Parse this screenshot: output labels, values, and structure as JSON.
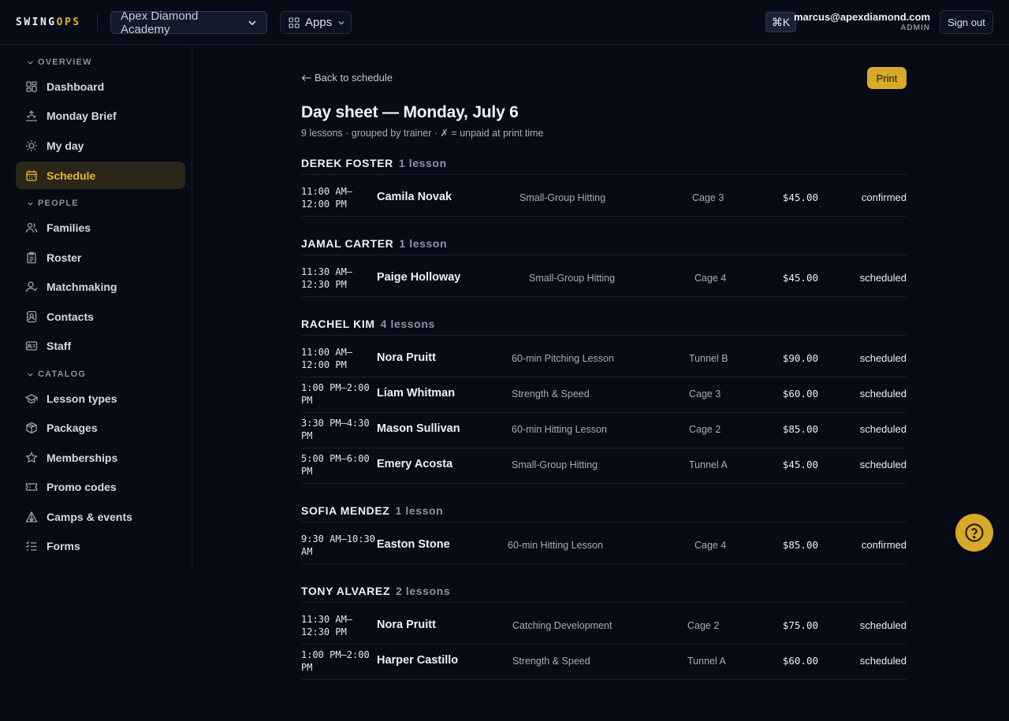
{
  "header": {
    "logo_main": "SWING",
    "logo_accent": "OPS",
    "org_name": "Apex Diamond Academy",
    "apps_label": "Apps",
    "shortcut_label": "⌘K",
    "user_email": "marcus@apexdiamond.com",
    "user_role": "ADMIN",
    "signout_label": "Sign out"
  },
  "sidebar": {
    "overview_label": "OVERVIEW",
    "people_label": "PEOPLE",
    "catalog_label": "CATALOG",
    "items": [
      {
        "label": "Dashboard",
        "icon": "grid-icon"
      },
      {
        "label": "Monday Brief",
        "icon": "sunrise-icon"
      },
      {
        "label": "My day",
        "icon": "sun-icon"
      },
      {
        "label": "Schedule",
        "icon": "calendar-icon",
        "active": true
      },
      {
        "label": "Families",
        "icon": "users-icon"
      },
      {
        "label": "Roster",
        "icon": "clipboard-icon"
      },
      {
        "label": "Matchmaking",
        "icon": "user-match-icon"
      },
      {
        "label": "Contacts",
        "icon": "contact-book-icon"
      },
      {
        "label": "Staff",
        "icon": "id-card-icon"
      },
      {
        "label": "Lesson types",
        "icon": "graduation-cap-icon"
      },
      {
        "label": "Packages",
        "icon": "box-icon"
      },
      {
        "label": "Memberships",
        "icon": "star-icon"
      },
      {
        "label": "Promo codes",
        "icon": "ticket-icon"
      },
      {
        "label": "Camps & events",
        "icon": "tent-icon"
      },
      {
        "label": "Forms",
        "icon": "checklist-icon"
      }
    ]
  },
  "main": {
    "back_label": "Back to schedule",
    "print_label": "Print",
    "title": "Day sheet — Monday, July 6",
    "subtitle": "9 lessons · grouped by trainer · ✗ = unpaid at print time",
    "trainers": [
      {
        "name": "DEREK FOSTER",
        "count": "1 lesson",
        "lessons": [
          {
            "time": "11:00 AM–12:00 PM",
            "student": "Camila Novak",
            "type": "Small-Group Hitting",
            "location": "Cage 3",
            "price": "$45.00",
            "status": "confirmed"
          }
        ]
      },
      {
        "name": "JAMAL CARTER",
        "count": "1 lesson",
        "lessons": [
          {
            "time": "11:30 AM–12:30 PM",
            "student": "Paige Holloway",
            "type": "Small-Group Hitting",
            "location": "Cage 4",
            "price": "$45.00",
            "status": "scheduled"
          }
        ]
      },
      {
        "name": "RACHEL KIM",
        "count": "4 lessons",
        "lessons": [
          {
            "time": "11:00 AM–12:00 PM",
            "student": "Nora Pruitt",
            "type": "60-min Pitching Lesson",
            "location": "Tunnel B",
            "price": "$90.00",
            "status": "scheduled"
          },
          {
            "time": "1:00 PM–2:00 PM",
            "student": "Liam Whitman",
            "type": "Strength & Speed",
            "location": "Cage 3",
            "price": "$60.00",
            "status": "scheduled"
          },
          {
            "time": "3:30 PM–4:30 PM",
            "student": "Mason Sullivan",
            "type": "60-min Hitting Lesson",
            "location": "Cage 2",
            "price": "$85.00",
            "status": "scheduled"
          },
          {
            "time": "5:00 PM–6:00 PM",
            "student": "Emery Acosta",
            "type": "Small-Group Hitting",
            "location": "Tunnel A",
            "price": "$45.00",
            "status": "scheduled"
          }
        ]
      },
      {
        "name": "SOFIA MENDEZ",
        "count": "1 lesson",
        "lessons": [
          {
            "time": "9:30 AM–10:30 AM",
            "student": "Easton Stone",
            "type": "60-min Hitting Lesson",
            "location": "Cage 4",
            "price": "$85.00",
            "status": "confirmed"
          }
        ]
      },
      {
        "name": "TONY ALVAREZ",
        "count": "2 lessons",
        "lessons": [
          {
            "time": "11:30 AM–12:30 PM",
            "student": "Nora Pruitt",
            "type": "Catching Development",
            "location": "Cage 2",
            "price": "$75.00",
            "status": "scheduled"
          },
          {
            "time": "1:00 PM–2:00 PM",
            "student": "Harper Castillo",
            "type": "Strength & Speed",
            "location": "Tunnel A",
            "price": "$60.00",
            "status": "scheduled"
          }
        ]
      }
    ]
  },
  "colors": {
    "background": "#070b16",
    "accent": "#d8aa2a",
    "active_nav_bg": "#2a2718",
    "active_nav_text": "#e8b92e"
  }
}
